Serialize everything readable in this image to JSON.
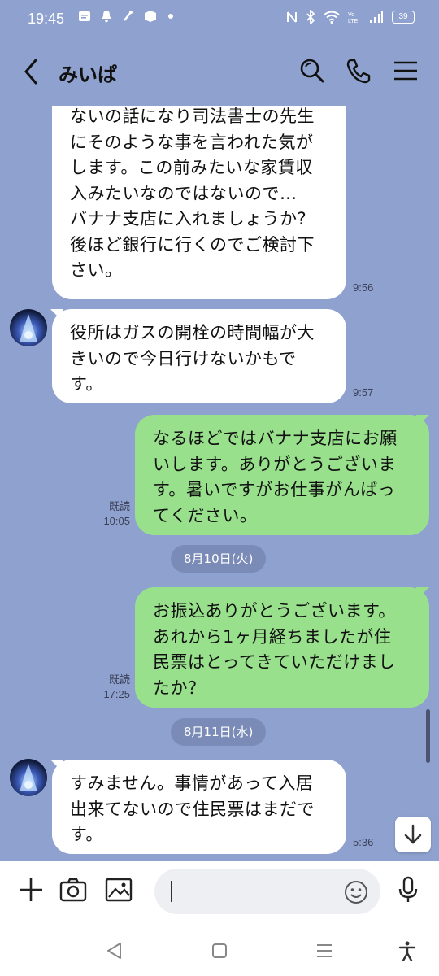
{
  "status_bar": {
    "time": "19:45",
    "battery": "39",
    "left_icons": [
      "message-icon",
      "bell-icon",
      "usb-icon",
      "app-icon",
      "dot-icon"
    ],
    "right_icons": [
      "nfc-icon",
      "bluetooth-icon",
      "wifi-icon",
      "volte-icon",
      "signal-icon",
      "battery-icon"
    ]
  },
  "header": {
    "title": "みいぱ",
    "icons": [
      "back-icon",
      "search-icon",
      "phone-icon",
      "menu-icon"
    ]
  },
  "messages": [
    {
      "side": "left",
      "text": "ないの話になり司法書士の先生\nにそのような事を言われた気が\nします。この前みたいな家賃収\n入みたいなのではないので…\nバナナ支店に入れましょうか?\n後ほど銀行に行くのでご検討下\nさい。",
      "time": "9:56"
    },
    {
      "side": "left",
      "text": "役所はガスの開栓の時間幅が大\nきいので今日行けないかもで\nす。",
      "time": "9:57"
    },
    {
      "side": "right",
      "text": "なるほどではバナナ支店にお願\nいします。ありがとうございま\nす。暑いですがお仕事がんばっ\nてください。",
      "read": "既読",
      "time": "10:05"
    },
    {
      "side": "right",
      "text": "お振込ありがとうございます。\nあれから1ヶ月経ちましたが住\n民票はとってきていただけまし\nたか？",
      "read": "既読",
      "time": "17:25"
    },
    {
      "side": "left",
      "text": "すみません。事情があって入居\n出来てないので住民票はまだで\nす。",
      "time": "5:36"
    }
  ],
  "dates": [
    "8月10日(火)",
    "8月11日(水)"
  ],
  "input": {
    "placeholder": ""
  },
  "colors": {
    "background": "#8fa2cf",
    "my_bubble": "#98e08b",
    "their_bubble": "#ffffff"
  }
}
